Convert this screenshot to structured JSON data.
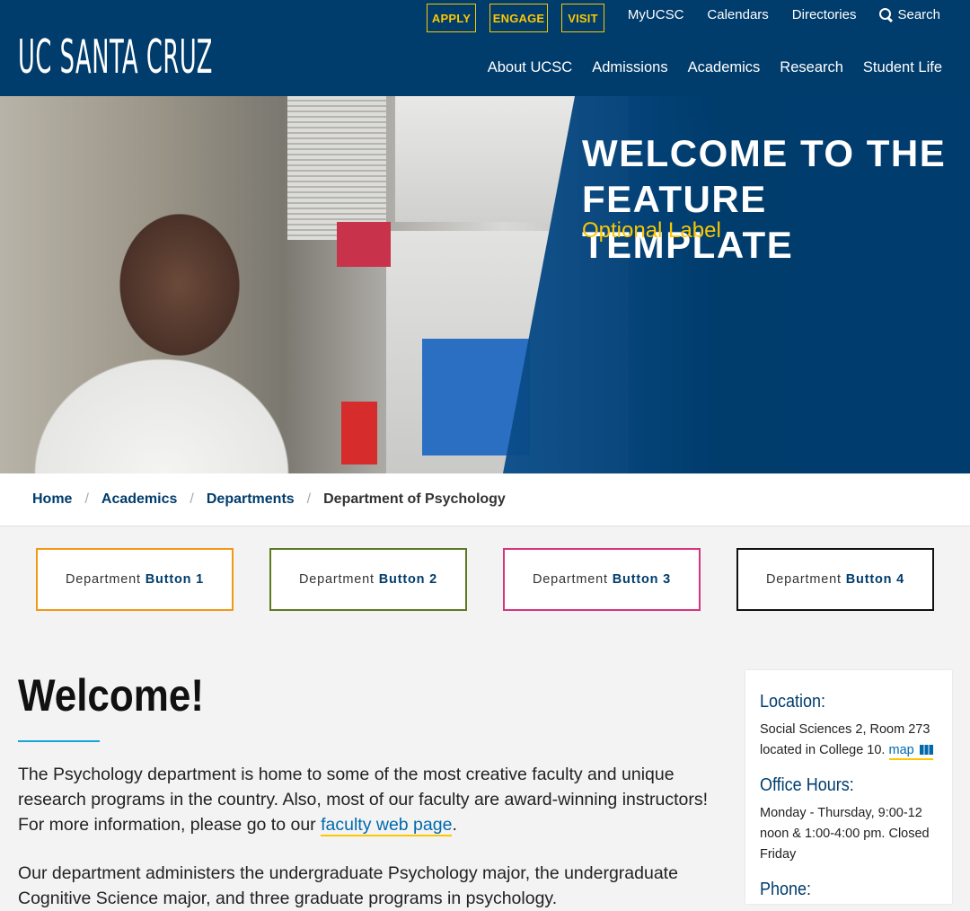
{
  "header": {
    "logo": "UC SANTA CRUZ",
    "cta": [
      "APPLY",
      "ENGAGE",
      "VISIT"
    ],
    "utility": [
      "MyUCSC",
      "Calendars",
      "Directories"
    ],
    "search_label": "Search",
    "nav": [
      "About UCSC",
      "Admissions",
      "Academics",
      "Research",
      "Student Life"
    ]
  },
  "hero": {
    "title": "WELCOME TO THE FEATURE TEMPLATE",
    "subtitle": "Optional Label"
  },
  "breadcrumb": {
    "items": [
      "Home",
      "Academics",
      "Departments"
    ],
    "separator": "/",
    "current": "Department of Psychology"
  },
  "dept_buttons": [
    {
      "prefix": "Department",
      "strong": "Button 1"
    },
    {
      "prefix": "Department",
      "strong": "Button 2"
    },
    {
      "prefix": "Department",
      "strong": "Button 3"
    },
    {
      "prefix": "Department",
      "strong": "Button 4"
    }
  ],
  "main": {
    "title": "Welcome!",
    "p1_before": "The Psychology department is home to some of the most creative faculty and unique research programs in the country. Also, most of our faculty are award-winning instructors! For more information, please go to our ",
    "p1_link": "faculty web page",
    "p1_after": ".",
    "p2": "Our department administers the undergraduate Psychology major, the undergraduate Cognitive Science major, and three graduate programs in psychology."
  },
  "sidebar": {
    "location_head": "Location:",
    "location_text": "Social Sciences 2, Room 273 located in College 10.",
    "map_link": "map",
    "hours_head": "Office Hours:",
    "hours_text": "Monday - Thursday, 9:00-12 noon & 1:00-4:00 pm. Closed Friday",
    "phone_head": "Phone:"
  },
  "colors": {
    "brand_blue": "#003c6c",
    "gold": "#fdc700",
    "link": "#006aad",
    "btn1": "#f29813",
    "btn2": "#5b7b1e",
    "btn3": "#d6357f",
    "btn4": "#111111"
  }
}
